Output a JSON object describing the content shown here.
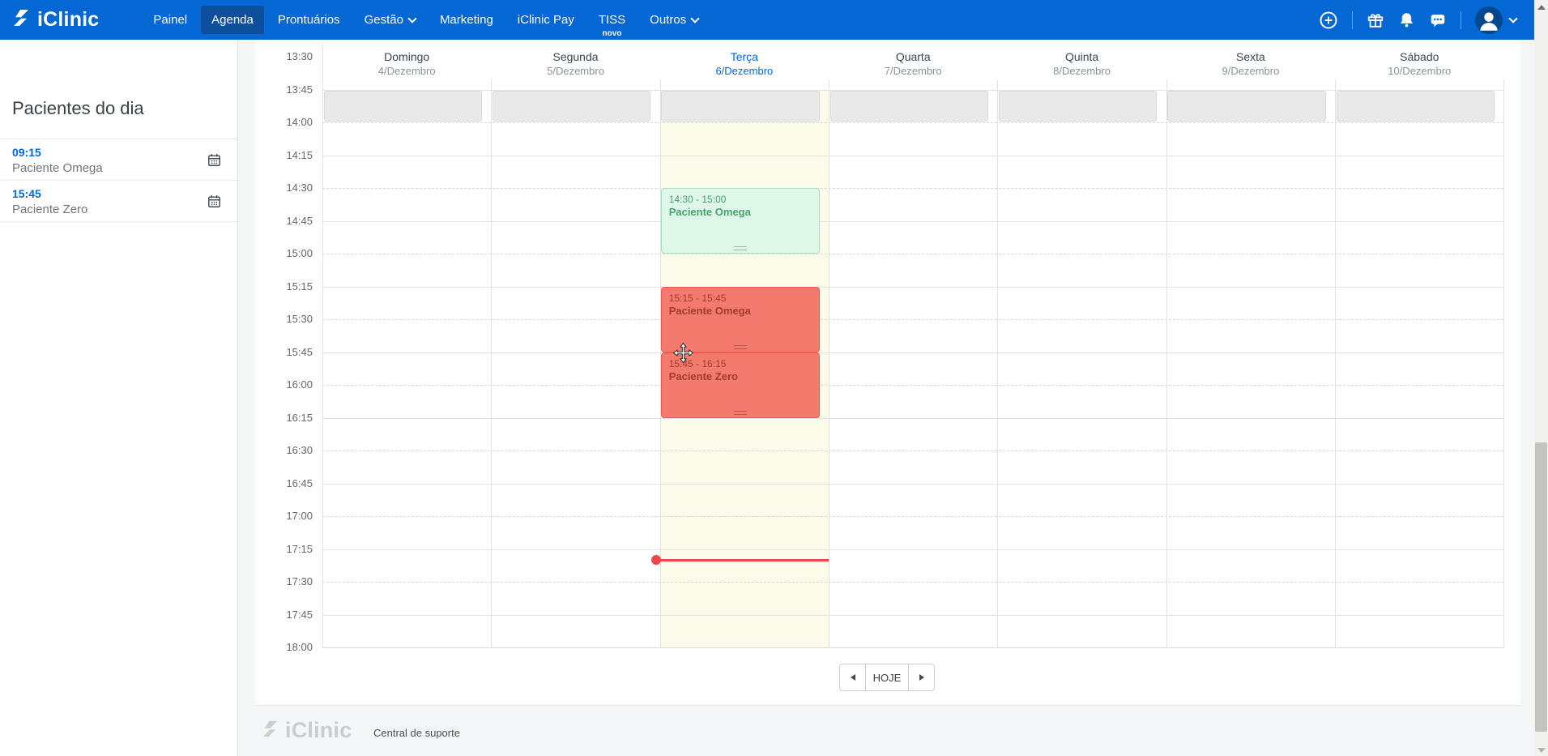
{
  "navbar": {
    "brand": "iClinic",
    "items": [
      {
        "label": "Painel",
        "active": false,
        "chevron": false,
        "badge": ""
      },
      {
        "label": "Agenda",
        "active": true,
        "chevron": false,
        "badge": ""
      },
      {
        "label": "Prontuários",
        "active": false,
        "chevron": false,
        "badge": ""
      },
      {
        "label": "Gestão",
        "active": false,
        "chevron": true,
        "badge": ""
      },
      {
        "label": "Marketing",
        "active": false,
        "chevron": false,
        "badge": ""
      },
      {
        "label": "iClinic Pay",
        "active": false,
        "chevron": false,
        "badge": ""
      },
      {
        "label": "TISS",
        "active": false,
        "chevron": false,
        "badge": "novo"
      },
      {
        "label": "Outros",
        "active": false,
        "chevron": true,
        "badge": ""
      }
    ],
    "action_icons": [
      "plus-circle-icon",
      "gift-icon",
      "bell-icon",
      "chat-icon"
    ],
    "avatar": "user-avatar"
  },
  "sidebar": {
    "title": "Pacientes do dia",
    "patients": [
      {
        "time": "09:15",
        "name": "Paciente Omega"
      },
      {
        "time": "15:45",
        "name": "Paciente Zero"
      }
    ]
  },
  "calendar": {
    "days": [
      {
        "name": "Domingo",
        "date": "4/Dezembro",
        "today": false
      },
      {
        "name": "Segunda",
        "date": "5/Dezembro",
        "today": false
      },
      {
        "name": "Terça",
        "date": "6/Dezembro",
        "today": true
      },
      {
        "name": "Quarta",
        "date": "7/Dezembro",
        "today": false
      },
      {
        "name": "Quinta",
        "date": "8/Dezembro",
        "today": false
      },
      {
        "name": "Sexta",
        "date": "9/Dezembro",
        "today": false
      },
      {
        "name": "Sábado",
        "date": "10/Dezembro",
        "today": false
      }
    ],
    "time_labels": [
      "13:30",
      "13:45",
      "14:00",
      "14:15",
      "14:30",
      "14:45",
      "15:00",
      "15:15",
      "15:30",
      "15:45",
      "16:00",
      "16:15",
      "16:30",
      "16:45",
      "17:00",
      "17:15",
      "17:30",
      "17:45",
      "18:00"
    ],
    "blocked_slot": {
      "start": "13:45",
      "end": "14:00"
    },
    "events": [
      {
        "time_range": "14:30 - 15:00",
        "start": "14:30",
        "end": "15:00",
        "name": "Paciente Omega",
        "day_index": 2,
        "color": "green"
      },
      {
        "time_range": "15:15 - 15:45",
        "start": "15:15",
        "end": "15:45",
        "name": "Paciente Omega",
        "day_index": 2,
        "color": "red"
      },
      {
        "time_range": "15:45 - 16:15",
        "start": "15:45",
        "end": "16:15",
        "name": "Paciente Zero",
        "day_index": 2,
        "color": "red"
      }
    ],
    "current_time": "17:20",
    "nav": {
      "today_label": "HOJE"
    }
  },
  "footer": {
    "brand": "iClinic",
    "support_link": "Central de suporte"
  },
  "colors": {
    "navbar_bg": "#0467d3",
    "navbar_active_bg": "#0d4f9c",
    "accent_blue": "#0269dc",
    "today_column_bg": "#fbfbe9",
    "event_green_bg": "#def7e8",
    "event_green_border": "#a6e2bf",
    "event_green_text": "#47a36d",
    "event_red_bg": "#f47a6d",
    "event_red_border": "#f0594b",
    "event_red_text": "#a23a31",
    "now_indicator": "#f0454d",
    "blocked_slot_bg": "#e9e9e9"
  }
}
